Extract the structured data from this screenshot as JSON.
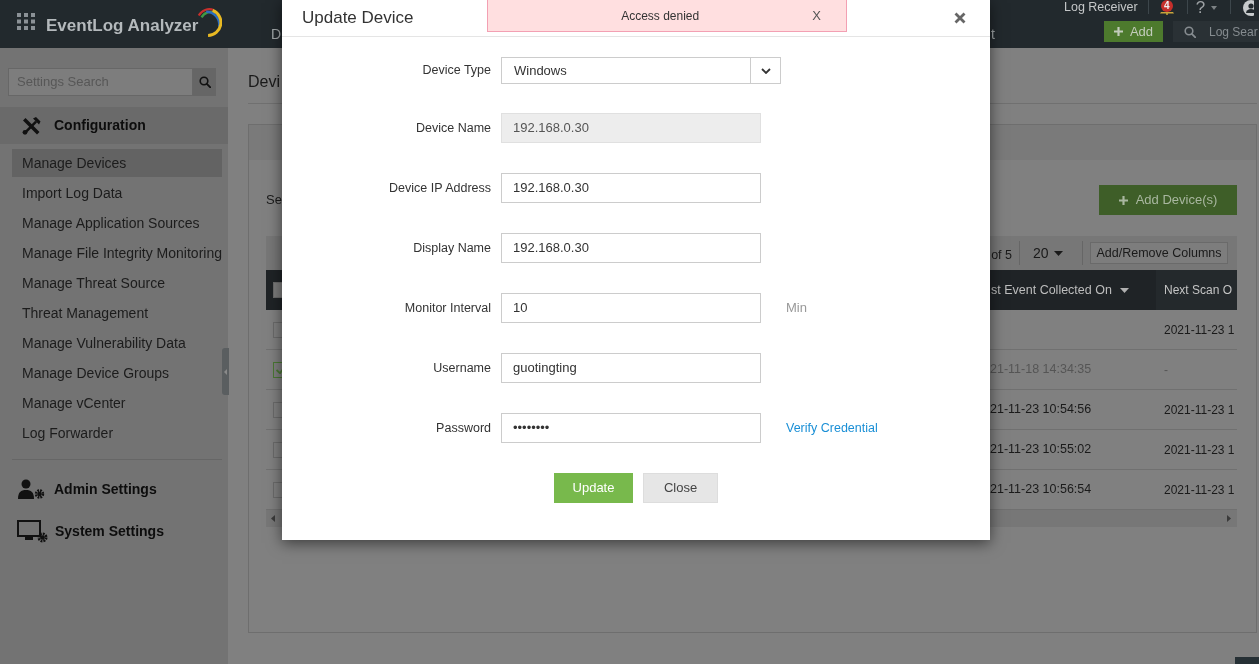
{
  "top_bar": {
    "logo_text": "EventLog Analyzer",
    "nav_fragments": [
      "D",
      "t"
    ],
    "log_receiver": "Log Receiver",
    "notification_count": "4",
    "help_label": "?",
    "add_label": "Add",
    "search_placeholder": "Log Sear"
  },
  "sidebar": {
    "search_placeholder": "Settings Search",
    "sections": [
      {
        "kind": "configuration",
        "title": "Configuration",
        "expanded": true,
        "items": [
          {
            "label": "Manage Devices",
            "selected": true
          },
          {
            "label": "Import Log Data",
            "selected": false
          },
          {
            "label": "Manage Application Sources",
            "selected": false
          },
          {
            "label": "Manage File Integrity Monitoring",
            "selected": false
          },
          {
            "label": "Manage Threat Source",
            "selected": false
          },
          {
            "label": "Threat Management",
            "selected": false
          },
          {
            "label": "Manage Vulnerability Data",
            "selected": false
          },
          {
            "label": "Manage Device Groups",
            "selected": false
          },
          {
            "label": "Manage vCenter",
            "selected": false
          },
          {
            "label": "Log Forwarder",
            "selected": false
          }
        ]
      },
      {
        "kind": "admin",
        "title": "Admin Settings",
        "expanded": false
      },
      {
        "kind": "system",
        "title": "System Settings",
        "expanded": false
      }
    ]
  },
  "page": {
    "title": "Devi",
    "select_label": "Se",
    "add_button": "Add Device(s)",
    "toolbar": {
      "page_info": "of 5",
      "page_size": "20",
      "columns_button": "Add/Remove Columns"
    },
    "table": {
      "header_checked": false,
      "columns": [
        "st Event Collected On",
        "Next Scan O"
      ],
      "rows": [
        {
          "checked": false,
          "disabled": false,
          "column_2": "2021-11-23 1"
        },
        {
          "checked": true,
          "disabled": true,
          "column_1": "21-11-18 14:34:35",
          "column_2": "-"
        },
        {
          "checked": false,
          "disabled": false,
          "column_1": "21-11-23 10:54:56",
          "column_2": "2021-11-23 1"
        },
        {
          "checked": false,
          "disabled": false,
          "column_1": "21-11-23 10:55:02",
          "column_2": "2021-11-23 1"
        },
        {
          "checked": false,
          "disabled": false,
          "column_1": "21-11-23 10:56:54",
          "column_2": "2021-11-23 1"
        }
      ]
    }
  },
  "dialog": {
    "title": "Update Device",
    "alert": {
      "text": "Access denied",
      "close_label": "X"
    },
    "fields": [
      {
        "kind": "select",
        "label": "Device Type",
        "value": "Windows",
        "disabled": false
      },
      {
        "kind": "text",
        "label": "Device Name",
        "value": "192.168.0.30",
        "disabled": true
      },
      {
        "kind": "text",
        "label": "Device IP Address",
        "value": "192.168.0.30",
        "disabled": false
      },
      {
        "kind": "text",
        "label": "Display Name",
        "value": "192.168.0.30",
        "disabled": false
      },
      {
        "kind": "text",
        "label": "Monitor Interval",
        "value": "10",
        "disabled": false,
        "suffix": "Min"
      },
      {
        "kind": "text",
        "label": "Username",
        "value": "guotingting",
        "disabled": false
      },
      {
        "kind": "password",
        "label": "Password",
        "value": "••••••••",
        "disabled": false,
        "link": "Verify Credential"
      }
    ],
    "buttons": [
      {
        "kind": "primary",
        "label": "Update"
      },
      {
        "kind": "secondary",
        "label": "Close"
      }
    ]
  }
}
